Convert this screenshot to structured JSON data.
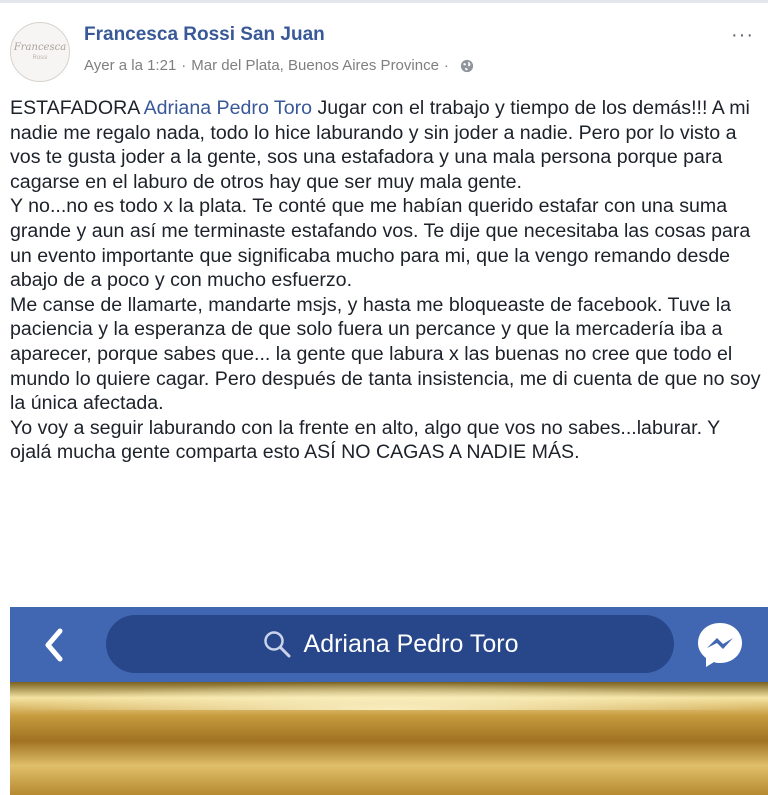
{
  "post": {
    "author": "Francesca Rossi San Juan",
    "timestamp": "Ayer a la 1:21",
    "separator": "·",
    "location": "Mar del Plata, Buenos Aires Province",
    "more_label": "···",
    "avatar_text": "Francesca",
    "avatar_subtext": "Rossi",
    "text_prefix": "ESTAFADORA ",
    "mention": "Adriana Pedro Toro",
    "text_body": " Jugar con el trabajo y tiempo de los demás!!! A mi nadie me regalo nada, todo lo hice laburando y sin joder a nadie. Pero por lo visto a vos te gusta joder a la gente, sos una estafadora y una mala persona porque para cagarse en el laburo de otros hay que ser muy mala gente.\nY no...no es todo x la plata. Te conté que me habían querido estafar con una suma grande y aun así me terminaste estafando vos. Te dije que necesitaba las cosas para un evento importante que significaba mucho para mi, que la vengo remando desde abajo de a poco y con mucho esfuerzo.\nMe canse de llamarte, mandarte msjs, y hasta me bloqueaste de facebook. Tuve la paciencia y la esperanza de que solo fuera un percance y que la mercadería iba a aparecer, porque sabes que... la gente que labura x las buenas no cree que todo el mundo lo quiere cagar. Pero después de tanta insistencia, me di cuenta de que no soy la única afectada.\nYo voy a seguir laburando con la frente en alto, algo que vos no sabes...laburar. Y ojalá mucha gente comparta esto ASÍ NO CAGAS A NADIE MÁS."
  },
  "screenshot": {
    "search_text": "Adriana Pedro Toro",
    "bar_color": "#4267b2",
    "pill_color": "#28478a",
    "gold_color": "#c79b3f"
  },
  "icons": {
    "globe": "globe-icon",
    "back": "chevron-left-icon",
    "search": "search-icon",
    "messenger": "messenger-icon"
  },
  "colors": {
    "link": "#385898",
    "meta": "#7f7f7f",
    "text": "#1d2129"
  }
}
